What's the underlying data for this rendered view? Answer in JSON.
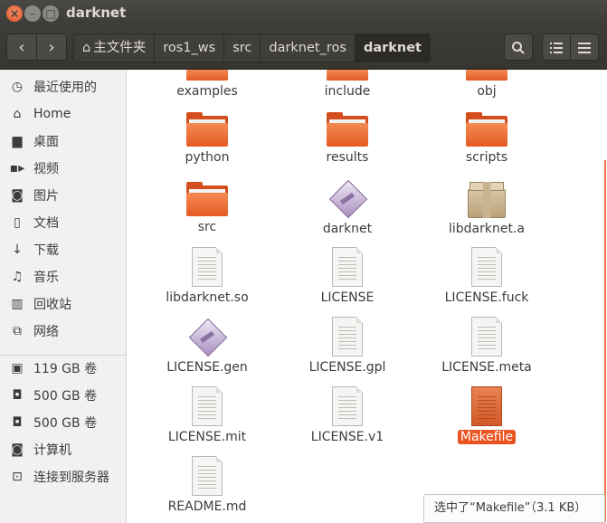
{
  "window": {
    "title": "darknet"
  },
  "header": {
    "breadcrumbs": [
      "主文件夹",
      "ros1_ws",
      "src",
      "darknet_ros",
      "darknet"
    ]
  },
  "sidebar": {
    "places": [
      "最近使用的",
      "Home",
      "桌面",
      "视频",
      "图片",
      "文档",
      "下载",
      "音乐",
      "回收站",
      "网络"
    ],
    "devices": [
      "119 GB 卷",
      "500 GB 卷",
      "500 GB 卷",
      "计算机",
      "连接到服务器"
    ]
  },
  "files": [
    {
      "name": "examples",
      "type": "folder"
    },
    {
      "name": "include",
      "type": "folder"
    },
    {
      "name": "obj",
      "type": "folder"
    },
    {
      "name": "python",
      "type": "folder"
    },
    {
      "name": "results",
      "type": "folder"
    },
    {
      "name": "scripts",
      "type": "folder"
    },
    {
      "name": "src",
      "type": "folder"
    },
    {
      "name": "darknet",
      "type": "executable"
    },
    {
      "name": "libdarknet.a",
      "type": "archive"
    },
    {
      "name": "libdarknet.so",
      "type": "text"
    },
    {
      "name": "LICENSE",
      "type": "text"
    },
    {
      "name": "LICENSE.fuck",
      "type": "text"
    },
    {
      "name": "LICENSE.gen",
      "type": "executable"
    },
    {
      "name": "LICENSE.gpl",
      "type": "text"
    },
    {
      "name": "LICENSE.meta",
      "type": "text"
    },
    {
      "name": "LICENSE.mit",
      "type": "text"
    },
    {
      "name": "LICENSE.v1",
      "type": "text"
    },
    {
      "name": "Makefile",
      "type": "makefile",
      "selected": true
    },
    {
      "name": "README.md",
      "type": "text"
    }
  ],
  "status": {
    "text": "选中了“Makefile”（3.1 KB）"
  },
  "colors": {
    "accent": "#e95420",
    "titlebar": "#3c3b37"
  }
}
